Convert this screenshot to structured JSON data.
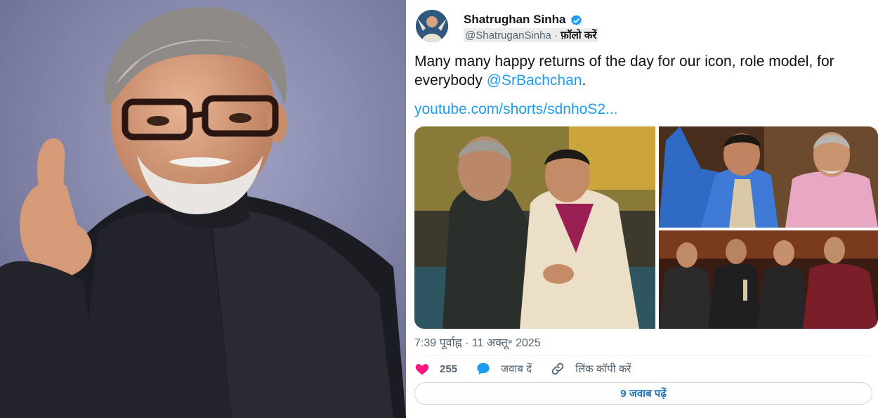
{
  "tweet": {
    "author_name": "Shatrughan Sinha",
    "handle": "@ShatruganSinha",
    "separator": "·",
    "follow_label": "फ़ॉलो करें",
    "text_main": "Many many happy returns of the day for our icon, role model, for everybody ",
    "mention": "@SrBachchan",
    "text_end": ".",
    "link": "youtube.com/shorts/sdnhoS2...",
    "timestamp": "7:39 पूर्वाह्न · 11 अक्तू॰ 2025",
    "like_count": "255",
    "reply_label": "जवाब दें",
    "copy_link_label": "लिंक कॉपी करें",
    "view_replies_label": "9 जवाब पढ़ें"
  },
  "icons": {
    "verified": "verified-badge-icon",
    "like": "heart-icon",
    "reply": "speech-bubble-icon",
    "copy": "link-icon"
  },
  "colors": {
    "accent": "#1d9bf0",
    "like": "#f91880",
    "text": "#0f1419",
    "muted": "#536471"
  }
}
